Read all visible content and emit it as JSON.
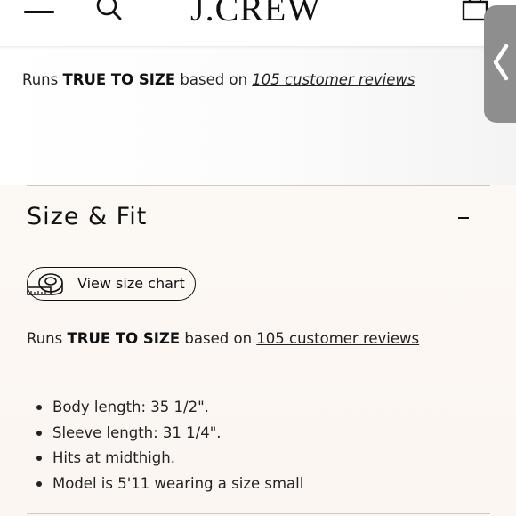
{
  "header": {
    "logo": "J.CREW",
    "icons": {
      "menu": "hamburger-menu-icon",
      "search": "search-icon",
      "bag": "shopping-bag-icon"
    }
  },
  "fit_summary_top": {
    "prefix": "Runs",
    "fit": "TRUE TO SIZE",
    "middle": "based on",
    "reviews_link": "105 customer reviews"
  },
  "side_panel": {
    "icon": "chevron-left-icon"
  },
  "size_fit": {
    "title": "Size & Fit",
    "collapse_label": "-",
    "size_chart_button": {
      "label": "View size chart",
      "icon": "measuring-tape-icon"
    },
    "summary": {
      "prefix": "Runs",
      "fit": "TRUE TO SIZE",
      "middle": "based on",
      "reviews_link": "105 customer reviews"
    },
    "details": [
      "Body length: 35 1/2\".",
      "Sleeve length: 31 1/4\".",
      "Hits at midthigh.",
      "Model is 5'11 wearing a size small"
    ]
  },
  "colors": {
    "text": "#111111",
    "divider": "#cfcac5",
    "section_bg": "#fbf6f1",
    "panel_tab": "#8e8e8e"
  }
}
